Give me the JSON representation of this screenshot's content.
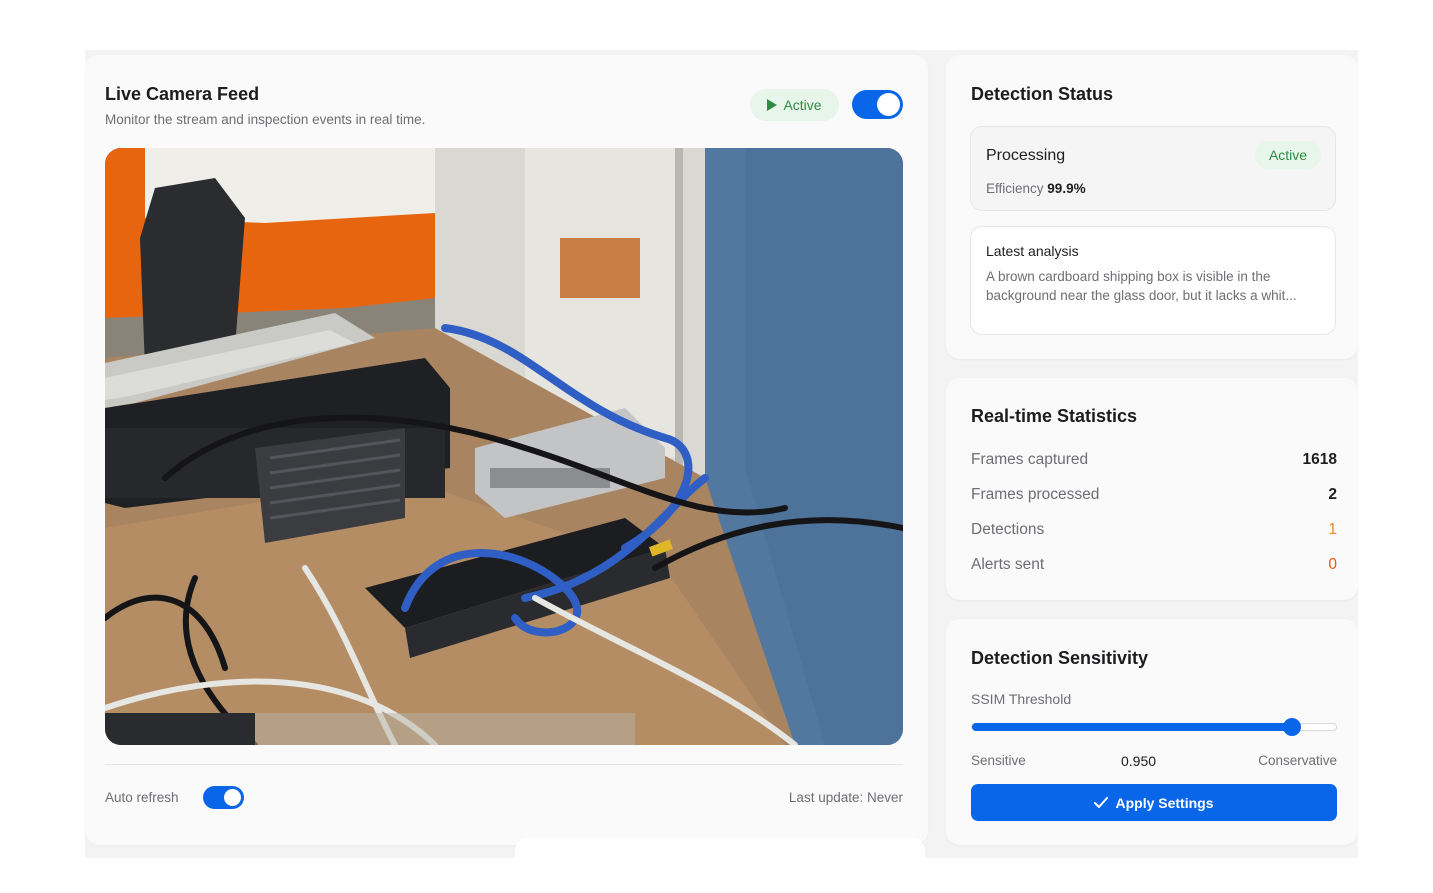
{
  "feed": {
    "title": "Live Camera Feed",
    "subtitle": "Monitor the stream and inspection events in real time.",
    "status_pill": "Active",
    "stream_toggle_on": true,
    "camera_image": "office desk with keyboard, network switch, blue ethernet cables, glass door",
    "auto_refresh_label": "Auto refresh",
    "auto_refresh_on": true,
    "last_update": "Last update: Never"
  },
  "detection_status": {
    "title": "Detection Status",
    "processing_label": "Processing",
    "processing_badge": "Active",
    "efficiency_label": "Efficiency",
    "efficiency_value": "99.9%",
    "analysis_title": "Latest analysis",
    "analysis_text": "A brown cardboard shipping box is visible in the background near the glass door, but it lacks a whit..."
  },
  "stats": {
    "title": "Real-time Statistics",
    "rows": [
      {
        "label": "Frames captured",
        "value": "1618"
      },
      {
        "label": "Frames processed",
        "value": "2"
      },
      {
        "label": "Detections",
        "value": "1"
      },
      {
        "label": "Alerts sent",
        "value": "0"
      }
    ]
  },
  "sensitivity": {
    "title": "Detection Sensitivity",
    "ssim_label": "SSIM Threshold",
    "slider_fraction": 0.88,
    "left_label": "Sensitive",
    "value": "0.950",
    "right_label": "Conservative",
    "apply_label": "Apply Settings"
  },
  "colors": {
    "accent": "#0a66e8",
    "success": "#2f8a44",
    "warning": "#f28a1a",
    "alert": "#e8561a"
  },
  "icons": [
    "play-icon",
    "check-icon"
  ]
}
